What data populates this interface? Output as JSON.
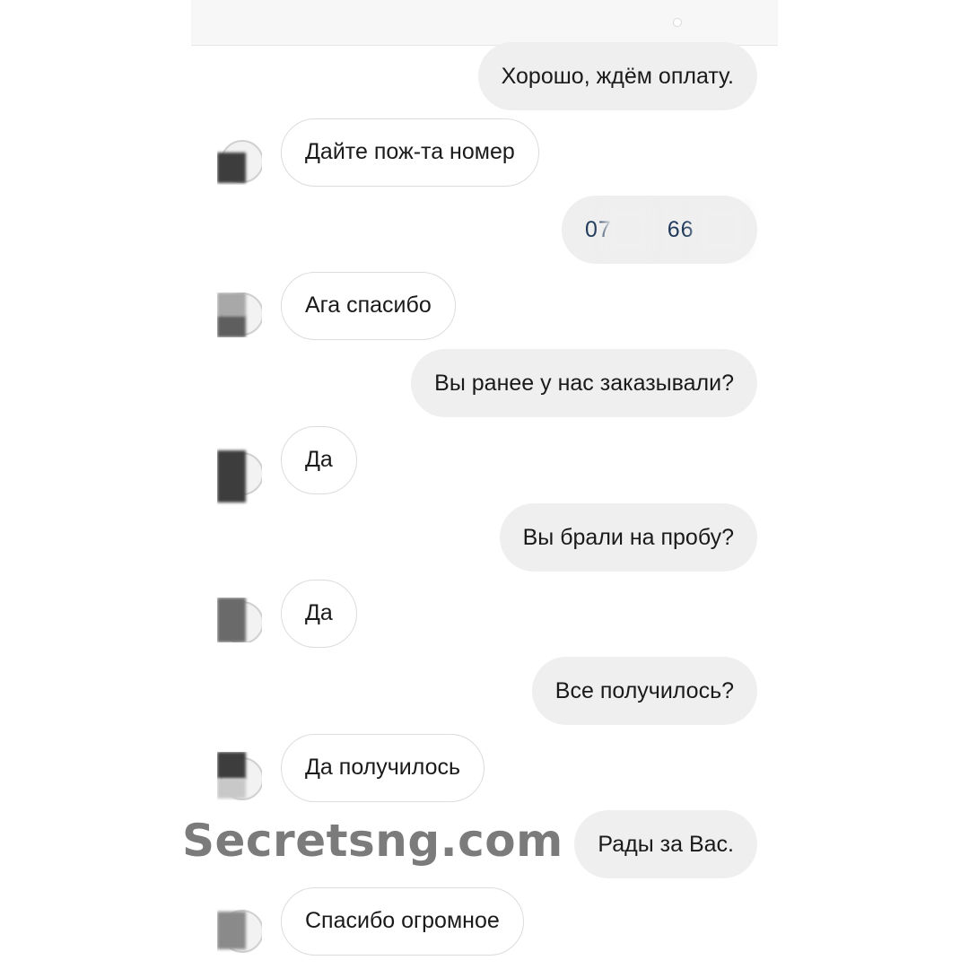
{
  "chat": {
    "messages": [
      {
        "side": "outgoing",
        "text": "Хорошо, ждём оплату."
      },
      {
        "side": "incoming",
        "text": "Дайте пож-та номер"
      },
      {
        "side": "outgoing",
        "text": "07 66",
        "phone_prefix": "07",
        "phone_middle": "66"
      },
      {
        "side": "incoming",
        "text": "Ага спасибо"
      },
      {
        "side": "outgoing",
        "text": "Вы ранее у нас заказывали?"
      },
      {
        "side": "incoming",
        "text": "Да"
      },
      {
        "side": "outgoing",
        "text": "Вы брали на пробу?"
      },
      {
        "side": "incoming",
        "text": "Да"
      },
      {
        "side": "outgoing",
        "text": "Все получилось?"
      },
      {
        "side": "incoming",
        "text": "Да получилось"
      },
      {
        "side": "outgoing",
        "text": "Рады за Вас."
      },
      {
        "side": "incoming",
        "text": "Спасибо огромное"
      }
    ]
  },
  "watermark": {
    "text": "Secretsng.com"
  },
  "colors": {
    "outgoing_bubble": "#efefef",
    "incoming_bubble": "#ffffff",
    "incoming_border": "#dcdcdc",
    "watermark": "#7b7b7b"
  }
}
